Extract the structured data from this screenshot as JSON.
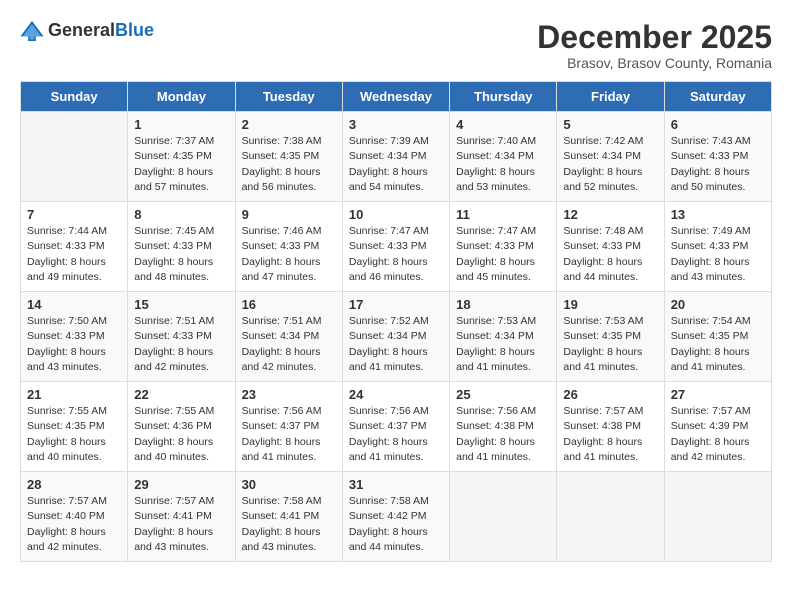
{
  "header": {
    "logo_general": "General",
    "logo_blue": "Blue",
    "month_year": "December 2025",
    "location": "Brasov, Brasov County, Romania"
  },
  "days_of_week": [
    "Sunday",
    "Monday",
    "Tuesday",
    "Wednesday",
    "Thursday",
    "Friday",
    "Saturday"
  ],
  "weeks": [
    [
      {
        "day": "",
        "sunrise": "",
        "sunset": "",
        "daylight": "",
        "empty": true
      },
      {
        "day": "1",
        "sunrise": "Sunrise: 7:37 AM",
        "sunset": "Sunset: 4:35 PM",
        "daylight": "Daylight: 8 hours and 57 minutes."
      },
      {
        "day": "2",
        "sunrise": "Sunrise: 7:38 AM",
        "sunset": "Sunset: 4:35 PM",
        "daylight": "Daylight: 8 hours and 56 minutes."
      },
      {
        "day": "3",
        "sunrise": "Sunrise: 7:39 AM",
        "sunset": "Sunset: 4:34 PM",
        "daylight": "Daylight: 8 hours and 54 minutes."
      },
      {
        "day": "4",
        "sunrise": "Sunrise: 7:40 AM",
        "sunset": "Sunset: 4:34 PM",
        "daylight": "Daylight: 8 hours and 53 minutes."
      },
      {
        "day": "5",
        "sunrise": "Sunrise: 7:42 AM",
        "sunset": "Sunset: 4:34 PM",
        "daylight": "Daylight: 8 hours and 52 minutes."
      },
      {
        "day": "6",
        "sunrise": "Sunrise: 7:43 AM",
        "sunset": "Sunset: 4:33 PM",
        "daylight": "Daylight: 8 hours and 50 minutes."
      }
    ],
    [
      {
        "day": "7",
        "sunrise": "Sunrise: 7:44 AM",
        "sunset": "Sunset: 4:33 PM",
        "daylight": "Daylight: 8 hours and 49 minutes."
      },
      {
        "day": "8",
        "sunrise": "Sunrise: 7:45 AM",
        "sunset": "Sunset: 4:33 PM",
        "daylight": "Daylight: 8 hours and 48 minutes."
      },
      {
        "day": "9",
        "sunrise": "Sunrise: 7:46 AM",
        "sunset": "Sunset: 4:33 PM",
        "daylight": "Daylight: 8 hours and 47 minutes."
      },
      {
        "day": "10",
        "sunrise": "Sunrise: 7:47 AM",
        "sunset": "Sunset: 4:33 PM",
        "daylight": "Daylight: 8 hours and 46 minutes."
      },
      {
        "day": "11",
        "sunrise": "Sunrise: 7:47 AM",
        "sunset": "Sunset: 4:33 PM",
        "daylight": "Daylight: 8 hours and 45 minutes."
      },
      {
        "day": "12",
        "sunrise": "Sunrise: 7:48 AM",
        "sunset": "Sunset: 4:33 PM",
        "daylight": "Daylight: 8 hours and 44 minutes."
      },
      {
        "day": "13",
        "sunrise": "Sunrise: 7:49 AM",
        "sunset": "Sunset: 4:33 PM",
        "daylight": "Daylight: 8 hours and 43 minutes."
      }
    ],
    [
      {
        "day": "14",
        "sunrise": "Sunrise: 7:50 AM",
        "sunset": "Sunset: 4:33 PM",
        "daylight": "Daylight: 8 hours and 43 minutes."
      },
      {
        "day": "15",
        "sunrise": "Sunrise: 7:51 AM",
        "sunset": "Sunset: 4:33 PM",
        "daylight": "Daylight: 8 hours and 42 minutes."
      },
      {
        "day": "16",
        "sunrise": "Sunrise: 7:51 AM",
        "sunset": "Sunset: 4:34 PM",
        "daylight": "Daylight: 8 hours and 42 minutes."
      },
      {
        "day": "17",
        "sunrise": "Sunrise: 7:52 AM",
        "sunset": "Sunset: 4:34 PM",
        "daylight": "Daylight: 8 hours and 41 minutes."
      },
      {
        "day": "18",
        "sunrise": "Sunrise: 7:53 AM",
        "sunset": "Sunset: 4:34 PM",
        "daylight": "Daylight: 8 hours and 41 minutes."
      },
      {
        "day": "19",
        "sunrise": "Sunrise: 7:53 AM",
        "sunset": "Sunset: 4:35 PM",
        "daylight": "Daylight: 8 hours and 41 minutes."
      },
      {
        "day": "20",
        "sunrise": "Sunrise: 7:54 AM",
        "sunset": "Sunset: 4:35 PM",
        "daylight": "Daylight: 8 hours and 41 minutes."
      }
    ],
    [
      {
        "day": "21",
        "sunrise": "Sunrise: 7:55 AM",
        "sunset": "Sunset: 4:35 PM",
        "daylight": "Daylight: 8 hours and 40 minutes."
      },
      {
        "day": "22",
        "sunrise": "Sunrise: 7:55 AM",
        "sunset": "Sunset: 4:36 PM",
        "daylight": "Daylight: 8 hours and 40 minutes."
      },
      {
        "day": "23",
        "sunrise": "Sunrise: 7:56 AM",
        "sunset": "Sunset: 4:37 PM",
        "daylight": "Daylight: 8 hours and 41 minutes."
      },
      {
        "day": "24",
        "sunrise": "Sunrise: 7:56 AM",
        "sunset": "Sunset: 4:37 PM",
        "daylight": "Daylight: 8 hours and 41 minutes."
      },
      {
        "day": "25",
        "sunrise": "Sunrise: 7:56 AM",
        "sunset": "Sunset: 4:38 PM",
        "daylight": "Daylight: 8 hours and 41 minutes."
      },
      {
        "day": "26",
        "sunrise": "Sunrise: 7:57 AM",
        "sunset": "Sunset: 4:38 PM",
        "daylight": "Daylight: 8 hours and 41 minutes."
      },
      {
        "day": "27",
        "sunrise": "Sunrise: 7:57 AM",
        "sunset": "Sunset: 4:39 PM",
        "daylight": "Daylight: 8 hours and 42 minutes."
      }
    ],
    [
      {
        "day": "28",
        "sunrise": "Sunrise: 7:57 AM",
        "sunset": "Sunset: 4:40 PM",
        "daylight": "Daylight: 8 hours and 42 minutes."
      },
      {
        "day": "29",
        "sunrise": "Sunrise: 7:57 AM",
        "sunset": "Sunset: 4:41 PM",
        "daylight": "Daylight: 8 hours and 43 minutes."
      },
      {
        "day": "30",
        "sunrise": "Sunrise: 7:58 AM",
        "sunset": "Sunset: 4:41 PM",
        "daylight": "Daylight: 8 hours and 43 minutes."
      },
      {
        "day": "31",
        "sunrise": "Sunrise: 7:58 AM",
        "sunset": "Sunset: 4:42 PM",
        "daylight": "Daylight: 8 hours and 44 minutes."
      },
      {
        "day": "",
        "sunrise": "",
        "sunset": "",
        "daylight": "",
        "empty": true
      },
      {
        "day": "",
        "sunrise": "",
        "sunset": "",
        "daylight": "",
        "empty": true
      },
      {
        "day": "",
        "sunrise": "",
        "sunset": "",
        "daylight": "",
        "empty": true
      }
    ]
  ]
}
